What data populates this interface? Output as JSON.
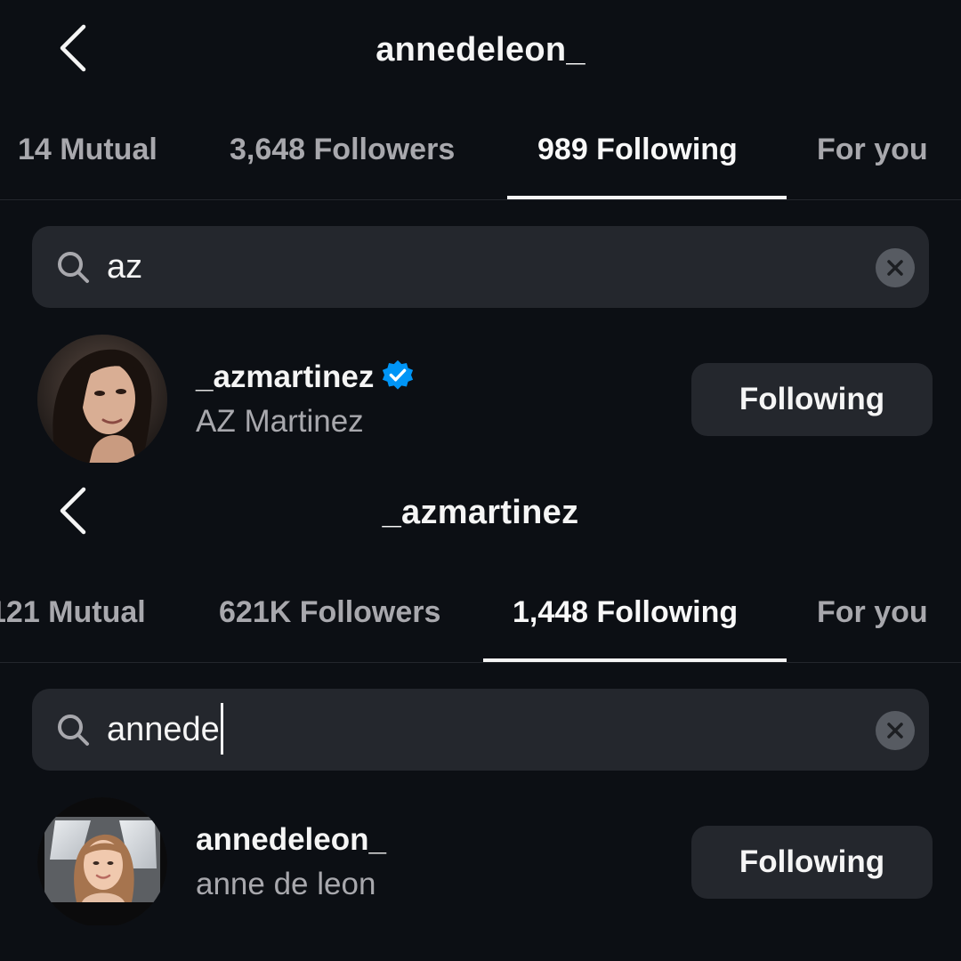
{
  "screens": [
    {
      "header": {
        "title": "annedeleon_"
      },
      "tabs": [
        {
          "label": "14 Mutual"
        },
        {
          "label": "3,648 Followers"
        },
        {
          "label": "989 Following"
        },
        {
          "label": "For you"
        }
      ],
      "active_tab": 2,
      "search": {
        "value": "az"
      },
      "result": {
        "username": "_azmartinez",
        "full_name": "AZ Martinez",
        "verified": true,
        "button_label": "Following"
      }
    },
    {
      "header": {
        "title": "_azmartinez"
      },
      "tabs": [
        {
          "label": "121 Mutual"
        },
        {
          "label": "621K Followers"
        },
        {
          "label": "1,448 Following"
        },
        {
          "label": "For you"
        }
      ],
      "active_tab": 2,
      "search": {
        "value": "annede"
      },
      "result": {
        "username": "annedeleon_",
        "full_name": "anne de leon",
        "verified": false,
        "button_label": "Following"
      }
    }
  ],
  "icons": {
    "back": "chevron-left-icon",
    "search": "search-icon",
    "clear": "clear-icon",
    "verified": "verified-badge-icon"
  },
  "colors": {
    "background": "#0c0f14",
    "surface": "#24272d",
    "text_primary": "#f5f5f5",
    "text_secondary": "#a8a8ad",
    "verified_blue": "#0095f6"
  }
}
